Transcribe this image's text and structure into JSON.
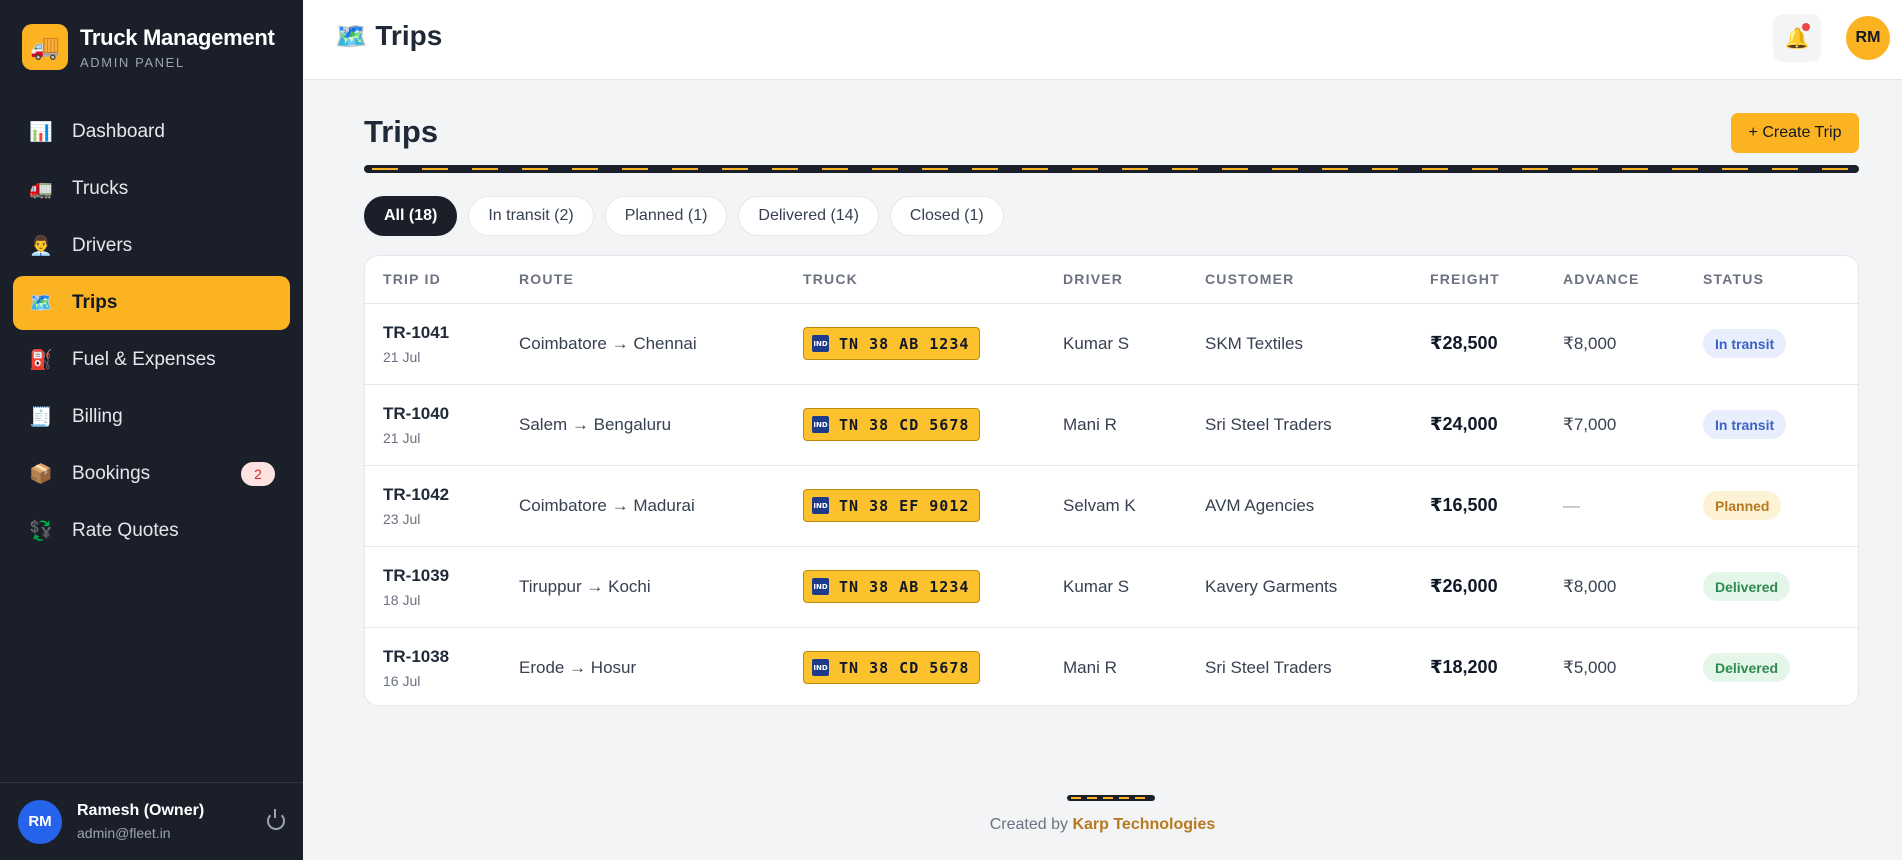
{
  "brand": {
    "title": "Truck Management",
    "subtitle": "ADMIN PANEL",
    "logo_icon": "truck-icon"
  },
  "sidebar": {
    "items": [
      {
        "label": "Dashboard",
        "icon": "📊"
      },
      {
        "label": "Trucks",
        "icon": "🚛"
      },
      {
        "label": "Drivers",
        "icon": "👨‍💼"
      },
      {
        "label": "Trips",
        "icon": "🗺️",
        "active": true
      },
      {
        "label": "Fuel & Expenses",
        "icon": "⛽"
      },
      {
        "label": "Billing",
        "icon": "🧾"
      },
      {
        "label": "Bookings",
        "icon": "📦",
        "badge": "2"
      },
      {
        "label": "Rate Quotes",
        "icon": "💱"
      }
    ]
  },
  "user": {
    "initials": "RM",
    "name": "Ramesh (Owner)",
    "email": "admin@fleet.in"
  },
  "topbar": {
    "title": "Trips",
    "title_icon": "🗺️",
    "avatar_initials": "RM",
    "bell_icon": "🔔"
  },
  "page": {
    "heading": "Trips",
    "create_label": "+ Create Trip"
  },
  "filters": [
    "All (18)",
    "In transit (2)",
    "Planned (1)",
    "Delivered (14)",
    "Closed (1)"
  ],
  "table": {
    "columns": [
      "TRIP ID",
      "ROUTE",
      "TRUCK",
      "DRIVER",
      "CUSTOMER",
      "FREIGHT",
      "ADVANCE",
      "STATUS"
    ],
    "plate_flag": "IND",
    "rows": [
      {
        "id": "TR-1041",
        "date": "21 Jul",
        "route": "Coimbatore → Chennai",
        "truck": "TN 38 AB 1234",
        "driver": "Kumar S",
        "customer": "SKM Textiles",
        "freight": "₹28,500",
        "advance": "₹8,000",
        "status": "In transit"
      },
      {
        "id": "TR-1040",
        "date": "21 Jul",
        "route": "Salem → Bengaluru",
        "truck": "TN 38 CD 5678",
        "driver": "Mani R",
        "customer": "Sri Steel Traders",
        "freight": "₹24,000",
        "advance": "₹7,000",
        "status": "In transit"
      },
      {
        "id": "TR-1042",
        "date": "23 Jul",
        "route": "Coimbatore → Madurai",
        "truck": "TN 38 EF 9012",
        "driver": "Selvam K",
        "customer": "AVM Agencies",
        "freight": "₹16,500",
        "advance": "—",
        "status": "Planned"
      },
      {
        "id": "TR-1039",
        "date": "18 Jul",
        "route": "Tiruppur → Kochi",
        "truck": "TN 38 AB 1234",
        "driver": "Kumar S",
        "customer": "Kavery Garments",
        "freight": "₹26,000",
        "advance": "₹8,000",
        "status": "Delivered"
      },
      {
        "id": "TR-1038",
        "date": "16 Jul",
        "route": "Erode → Hosur",
        "truck": "TN 38 CD 5678",
        "driver": "Mani R",
        "customer": "Sri Steel Traders",
        "freight": "₹18,200",
        "advance": "₹5,000",
        "status": "Delivered"
      }
    ]
  },
  "footer": {
    "prefix": "Created by",
    "company": "Karp Technologies"
  },
  "colors": {
    "accent": "#fbb321",
    "sidebar_bg": "#1b1f2a",
    "transit": "#3b63c4",
    "planned": "#b7791f",
    "delivered": "#2f8a4e"
  }
}
